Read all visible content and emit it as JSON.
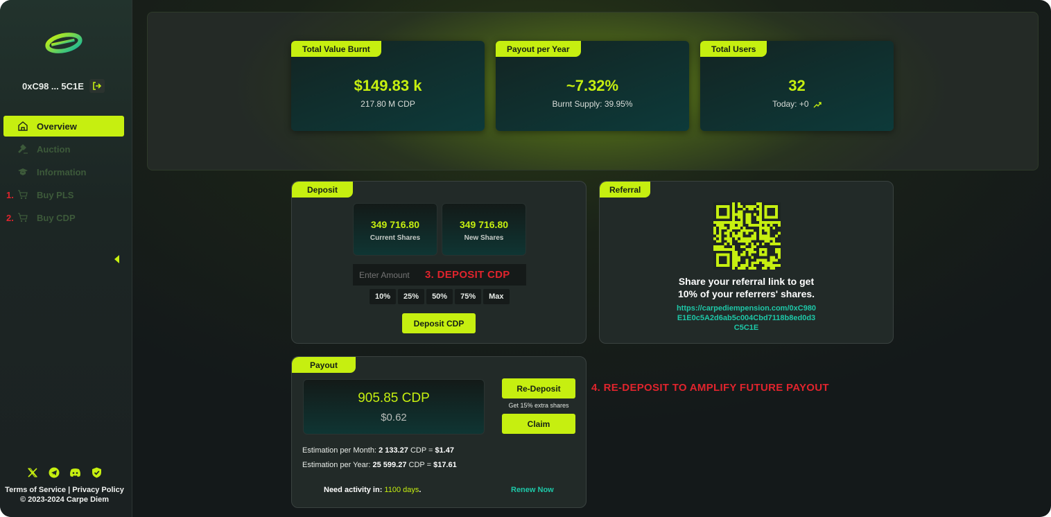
{
  "sidebar": {
    "wallet_address": "0xC98 ... 5C1E",
    "nav": [
      {
        "label": "Overview",
        "icon": "home-icon",
        "active": true,
        "step": ""
      },
      {
        "label": "Auction",
        "icon": "gavel-icon",
        "active": false,
        "step": ""
      },
      {
        "label": "Information",
        "icon": "book-icon",
        "active": false,
        "step": ""
      },
      {
        "label": "Buy PLS",
        "icon": "cart-icon",
        "active": false,
        "step": "1."
      },
      {
        "label": "Buy CDP",
        "icon": "cart-icon",
        "active": false,
        "step": "2."
      }
    ],
    "socials": [
      "x-icon",
      "telegram-icon",
      "discord-icon",
      "shield-check-icon"
    ],
    "footer_terms": "Terms of Service",
    "footer_sep": " | ",
    "footer_privacy": "Privacy Policy",
    "copyright": "© 2023-2024 Carpe Diem"
  },
  "stats": [
    {
      "tab": "Total Value Burnt",
      "value": "$149.83 k",
      "sub": "217.80 M CDP"
    },
    {
      "tab": "Payout per Year",
      "value": "~7.32%",
      "sub": "Burnt Supply: 39.95%"
    },
    {
      "tab": "Total Users",
      "value": "32",
      "sub": "Today: +0"
    }
  ],
  "deposit": {
    "tab": "Deposit",
    "current_shares_value": "349 716.80",
    "current_shares_label": "Current Shares",
    "new_shares_value": "349 716.80",
    "new_shares_label": "New Shares",
    "amount_placeholder": "Enter Amount",
    "note": "3. DEPOSIT CDP",
    "percents": [
      "10%",
      "25%",
      "50%",
      "75%",
      "Max"
    ],
    "button": "Deposit CDP"
  },
  "referral": {
    "tab": "Referral",
    "line1": "Share your referral link to get",
    "line2": "10% of your referrers' shares.",
    "link1": "https://carpediempension.com/0xC980",
    "link2": "E1E0c5A2d6ab5c004Cbd7118b8ed0d3",
    "link3": "C5C1E"
  },
  "payout": {
    "tab": "Payout",
    "amount": "905.85 CDP",
    "usd": "$0.62",
    "redeposit_button": "Re-Deposit",
    "extra_note": "Get 15% extra shares",
    "claim_button": "Claim",
    "note": "4. RE-DEPOSIT TO AMPLIFY FUTURE PAYOUT",
    "month_label": "Estimation per Month: ",
    "month_cdp": "2 133.27",
    "month_mid": " CDP = ",
    "month_usd": "$1.47",
    "year_label": "Estimation per Year: ",
    "year_cdp": "25 599.27",
    "year_mid": " CDP = ",
    "year_usd": "$17.61",
    "activity_label": "Need activity in: ",
    "activity_days": "1100 days",
    "activity_dot": ".",
    "renew": "Renew Now"
  },
  "colors": {
    "accent": "#c6ef10",
    "alert": "#e0242d",
    "link": "#1ec8a8"
  }
}
